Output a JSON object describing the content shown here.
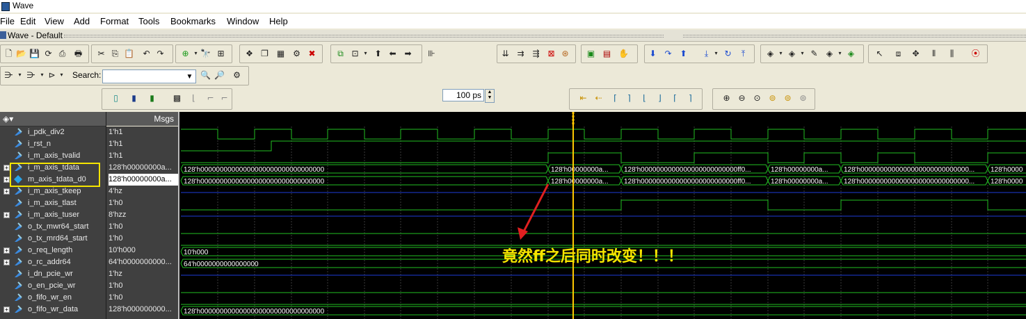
{
  "window": {
    "title": "Wave"
  },
  "menu": [
    "File",
    "Edit",
    "View",
    "Add",
    "Format",
    "Tools",
    "Bookmarks",
    "Window",
    "Help"
  ],
  "wave_tab": {
    "title": "Wave - Default"
  },
  "toolbar": {
    "search_label": "Search:",
    "search_value": "",
    "step_value": "100 ps"
  },
  "header": {
    "msgs": "Msgs"
  },
  "signals": [
    {
      "name": "i_pdk_div2",
      "value": "1'h1",
      "expandable": false
    },
    {
      "name": "i_rst_n",
      "value": "1'h1",
      "expandable": false
    },
    {
      "name": "i_m_axis_tvalid",
      "value": "1'h1",
      "expandable": false
    },
    {
      "name": "i_m_axis_tdata",
      "value": "128'h00000000a...",
      "expandable": true
    },
    {
      "name": "m_axis_tdata_d0",
      "value": "128'h00000000a...",
      "expandable": true
    },
    {
      "name": "i_m_axis_tkeep",
      "value": "4'hz",
      "expandable": true
    },
    {
      "name": "i_m_axis_tlast",
      "value": "1'h0",
      "expandable": false
    },
    {
      "name": "i_m_axis_tuser",
      "value": "8'hzz",
      "expandable": true
    },
    {
      "name": "o_tx_mwr64_start",
      "value": "1'h0",
      "expandable": false
    },
    {
      "name": "o_tx_mrd64_start",
      "value": "1'h0",
      "expandable": false
    },
    {
      "name": "o_req_length",
      "value": "10'h000",
      "expandable": true
    },
    {
      "name": "o_rc_addr64",
      "value": "64'h0000000000...",
      "expandable": true
    },
    {
      "name": "i_dn_pcie_wr",
      "value": "1'hz",
      "expandable": false
    },
    {
      "name": "o_en_pcie_wr",
      "value": "1'h0",
      "expandable": false
    },
    {
      "name": "o_fifo_wr_en",
      "value": "1'h0",
      "expandable": false
    },
    {
      "name": "o_fifo_wr_data",
      "value": "128'h000000000...",
      "expandable": true
    }
  ],
  "wave_labels": {
    "tdata_init": "128'h00000000000000000000000000000000",
    "tdata_a1": "128'h00000000a...",
    "tdata_ff": "128'h0000000000000000000000000ff0...",
    "tdata_a2": "128'h00000000a...",
    "tdata_long": "128'h0000000000000000000000000000...",
    "tdata_tail": "128'h0000",
    "req_length": "10'h000",
    "rc_addr": "64'h0000000000000000",
    "fifo_data": "128'h00000000000000000000000000000000"
  },
  "annotation": "竟然ff之后同时改变！！！",
  "colors": {
    "wave_green": "#22c022",
    "hiz_blue": "#1e3cd8",
    "cursor_yellow": "#ffc800",
    "annotation_yellow": "#f5e400",
    "arrow_red": "#e02020"
  }
}
